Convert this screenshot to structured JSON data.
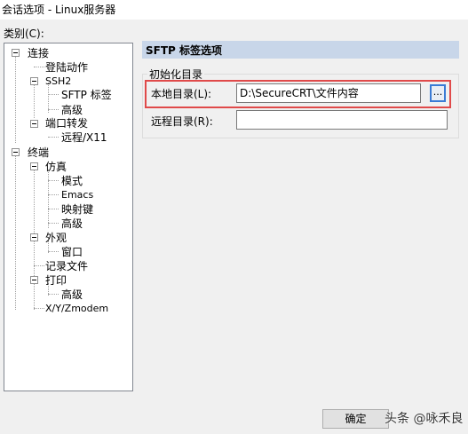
{
  "window": {
    "title": "会话选项 - Linux服务器"
  },
  "category_label": "类别(C):",
  "tree": [
    {
      "label": "连接",
      "expanded": true
    },
    {
      "label": "登陆动作"
    },
    {
      "label": "SSH2",
      "expanded": true
    },
    {
      "label": "SFTP 标签",
      "selected": true
    },
    {
      "label": "高级"
    },
    {
      "label": "端口转发",
      "expanded": true
    },
    {
      "label": "远程/X11"
    },
    {
      "label": "终端",
      "expanded": true
    },
    {
      "label": "仿真",
      "expanded": true
    },
    {
      "label": "模式"
    },
    {
      "label": "Emacs"
    },
    {
      "label": "映射键"
    },
    {
      "label": "高级"
    },
    {
      "label": "外观",
      "expanded": true
    },
    {
      "label": "窗口"
    },
    {
      "label": "记录文件"
    },
    {
      "label": "打印",
      "expanded": true
    },
    {
      "label": "高级"
    },
    {
      "label": "X/Y/Zmodem"
    }
  ],
  "section": {
    "title": "SFTP 标签选项",
    "group_title": "初始化目录",
    "local_dir_label": "本地目录(L):",
    "local_dir_value": "D:\\SecureCRT\\文件内容",
    "browse_label": "...",
    "remote_dir_label": "远程目录(R):",
    "remote_dir_value": ""
  },
  "buttons": {
    "ok": "确定"
  },
  "watermark": "头条 @咏禾良",
  "colors": {
    "header_bg": "#c8d6e9",
    "highlight": "#e04a4a",
    "focus_border": "#3a7bd5"
  }
}
